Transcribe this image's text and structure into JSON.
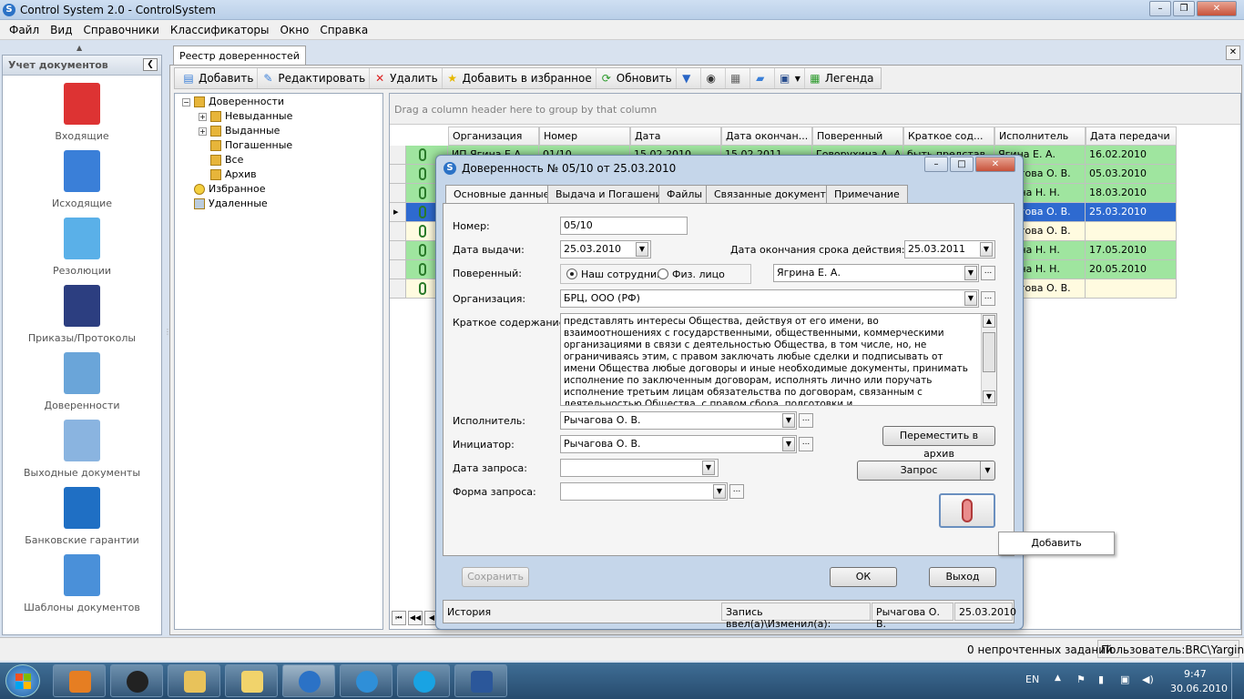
{
  "app": {
    "title": "Control System 2.0 - ControlSystem",
    "icon": "app-logo-icon"
  },
  "menu": [
    "Файл",
    "Вид",
    "Справочники",
    "Классификаторы",
    "Окно",
    "Справка"
  ],
  "leftpanel": {
    "header": "Учет документов",
    "items": [
      {
        "label": "Входящие",
        "icon": "incoming-docs-icon",
        "color": "#d33"
      },
      {
        "label": "Исходящие",
        "icon": "outgoing-docs-icon",
        "color": "#3a7fd8"
      },
      {
        "label": "Резолюции",
        "icon": "resolution-scroll-icon",
        "color": "#5ab0e8"
      },
      {
        "label": "Приказы/Протоколы",
        "icon": "orders-notebook-icon",
        "color": "#2c3e80"
      },
      {
        "label": "Доверенности",
        "icon": "power-of-attorney-icon",
        "color": "#6aa5d9"
      },
      {
        "label": "Выходные документы",
        "icon": "output-docs-icon",
        "color": "#8ab4e0"
      },
      {
        "label": "Банковские гарантии",
        "icon": "umbrella-icon",
        "color": "#1f6fc4"
      },
      {
        "label": "Шаблоны документов",
        "icon": "templates-grid-icon",
        "color": "#4a90d9"
      }
    ]
  },
  "outer_tab": "Реестр доверенностей",
  "toolbar": {
    "add": "Добавить",
    "edit": "Редактировать",
    "delete": "Удалить",
    "favorite": "Добавить в избранное",
    "refresh": "Обновить",
    "legend": "Легенда"
  },
  "tree": [
    {
      "label": "Доверенности",
      "level": 0,
      "expander": "−"
    },
    {
      "label": "Невыданные",
      "level": 1,
      "expander": "+"
    },
    {
      "label": "Выданные",
      "level": 1,
      "expander": "+"
    },
    {
      "label": "Погашенные",
      "level": 1,
      "expander": ""
    },
    {
      "label": "Все",
      "level": 1,
      "expander": ""
    },
    {
      "label": "Архив",
      "level": 1,
      "expander": ""
    },
    {
      "label": "Избранное",
      "level": 0,
      "expander": ""
    },
    {
      "label": "Удаленные",
      "level": 0,
      "expander": ""
    }
  ],
  "grid": {
    "group_hint": "Drag a column header here to group by that column",
    "columns": [
      "Организация",
      "Номер",
      "Дата",
      "Дата окончан...",
      "Поверенный",
      "Краткое сод...",
      "Исполнитель",
      "Дата передачи"
    ],
    "rows": [
      {
        "cells": [
          "ИП Ягина Е.А.",
          "01/10",
          "15.02.2010",
          "15.02.2011",
          "Говорухина А. А.",
          "быть представ...",
          "Ягина Е. А.",
          "16.02.2010"
        ],
        "color": "#9fe59f"
      },
      {
        "cells": [
          "",
          "",
          "",
          "",
          "",
          "",
          "...чагова О. В.",
          "05.03.2010"
        ],
        "color": "#9fe59f"
      },
      {
        "cells": [
          "",
          "",
          "",
          "",
          "",
          "",
          "...гина Н. Н.",
          "18.03.2010"
        ],
        "color": "#9fe59f"
      },
      {
        "cells": [
          "",
          "",
          "",
          "",
          "",
          "",
          "...чагова О. В.",
          "25.03.2010"
        ],
        "color": "#2e6ad0"
      },
      {
        "cells": [
          "",
          "",
          "",
          "",
          "",
          "",
          "...чагова О. В.",
          ""
        ],
        "color": "#fffbe0"
      },
      {
        "cells": [
          "",
          "",
          "",
          "",
          "",
          "",
          "...гина Н. Н.",
          "17.05.2010"
        ],
        "color": "#9fe59f"
      },
      {
        "cells": [
          "",
          "",
          "",
          "",
          "",
          "",
          "...гина Н. Н.",
          "20.05.2010"
        ],
        "color": "#9fe59f"
      },
      {
        "cells": [
          "",
          "",
          "",
          "",
          "",
          "",
          "...чагова О. В.",
          ""
        ],
        "color": "#fffbe0"
      }
    ]
  },
  "dialog": {
    "title": "Доверенность № 05/10 от 25.03.2010",
    "tabs": [
      "Основные данные",
      "Выдача и Погашение",
      "Файлы",
      "Связанные документы",
      "Примечание"
    ],
    "number_label": "Номер:",
    "number": "05/10",
    "issue_date_label": "Дата выдачи:",
    "issue_date": "25.03.2010",
    "expiry_label": "Дата окончания срока действия:",
    "expiry_date": "25.03.2011",
    "attorney_label": "Поверенный:",
    "radio_employee": "Наш сотрудник",
    "radio_person": "Физ. лицо",
    "attorney": "Ягрина Е. А.",
    "org_label": "Организация:",
    "org": "БРЦ, ООО (РФ)",
    "summary_label": "Краткое содержание:",
    "summary": "представлять интересы Общества, действуя от его имени, во взаимоотношениях с государственными, общественными, коммерческими организациями в связи с деятельностью Общества, в том числе, но, не ограничиваясь этим, с правом заключать любые сделки и подписывать от имени Общества любые договоры и иные необходимые документы, принимать исполнение по заключенным договорам, исполнять лично или поручать исполнение третьим лицам обязательства по договорам, связанным с деятельностью Общества, с правом сбора, подготовки и",
    "executor_label": "Исполнитель:",
    "executor": "Рычагова О. В.",
    "initiator_label": "Инициатор:",
    "initiator": "Рычагова О. В.",
    "req_date_label": "Дата запроса:",
    "req_form_label": "Форма запроса:",
    "archive_btn": "Переместить в архив",
    "request_btn": "Запрос",
    "popup_add": "Добавить",
    "save_btn": "Сохранить",
    "ok_btn": "ОК",
    "exit_btn": "Выход",
    "history": "История",
    "entered_label": "Запись ввел(а)\\Изменил(а):",
    "entered_by": "Рычагова О. В.",
    "entered_date": "25.03.2010"
  },
  "status": {
    "tasks": "0 непрочтенных заданий",
    "user": "Пользователь:BRC\\Yargina"
  },
  "taskbar": {
    "lang": "EN",
    "time": "9:47",
    "date": "30.06.2010"
  }
}
